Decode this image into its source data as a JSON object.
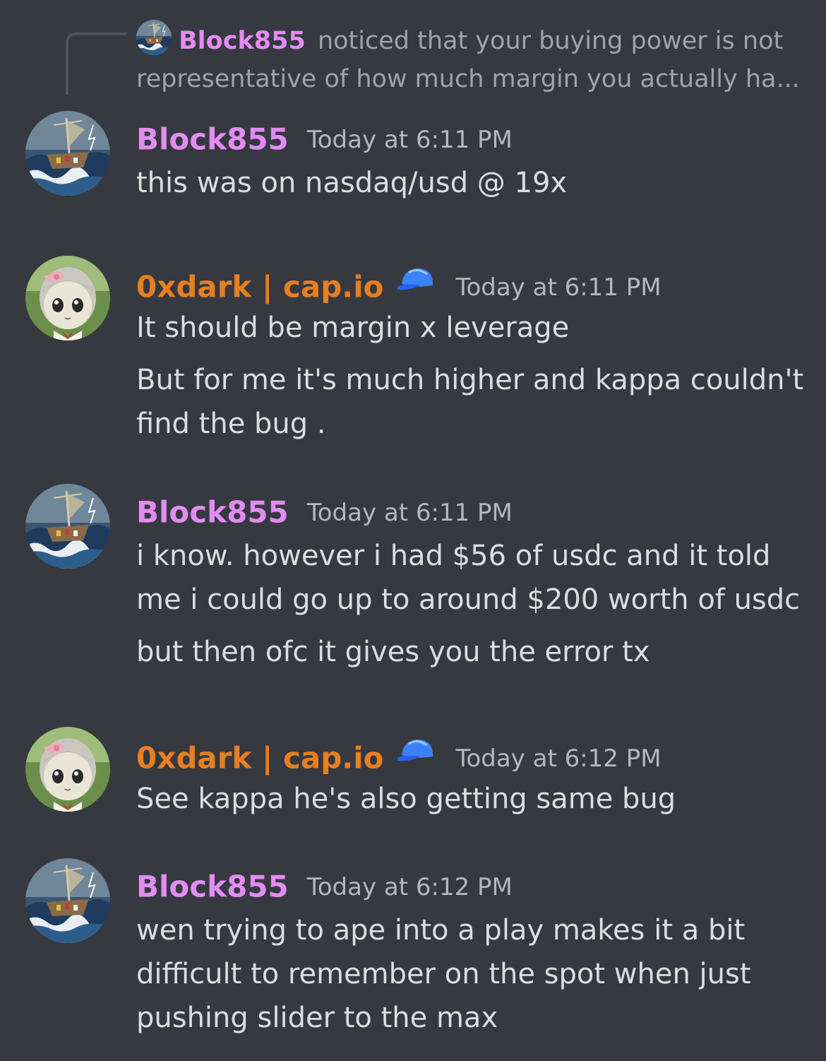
{
  "reply": {
    "author": "Block855",
    "preview": "noticed that your buying power is not",
    "preview_line2": "representative of how much margin you actually ha..."
  },
  "messages": [
    {
      "author": "Block855",
      "timestamp": "Today at 6:11 PM",
      "lines": [
        "this was on nasdaq/usd @ 19x"
      ]
    },
    {
      "author": "0xdark | cap.io",
      "badge": "cap-icon",
      "timestamp": "Today at 6:11 PM",
      "lines": [
        "It should be margin x leverage",
        "But for me it's much higher and kappa couldn't",
        "find the bug ."
      ]
    },
    {
      "author": "Block855",
      "timestamp": "Today at 6:11 PM",
      "lines": [
        "i know. however i had $56 of usdc and it told",
        "me i could go up to around $200 worth of usdc",
        "but then ofc it gives you the error tx"
      ]
    },
    {
      "author": "0xdark | cap.io",
      "badge": "cap-icon",
      "timestamp": "Today at 6:12 PM",
      "lines": [
        "See kappa he's also getting same bug"
      ]
    },
    {
      "author": "Block855",
      "timestamp": "Today at 6:12 PM",
      "lines": [
        "wen trying to ape into a play makes it a bit",
        "difficult to remember on the spot when just",
        "pushing slider to the max"
      ]
    }
  ],
  "colors": {
    "background": "#36393f",
    "block855_name": "#e28cf2",
    "oxdark_name": "#e67e22",
    "message_text": "#dcddde",
    "timestamp": "#b4b7bb",
    "badge_blue": "#3b82f6"
  }
}
